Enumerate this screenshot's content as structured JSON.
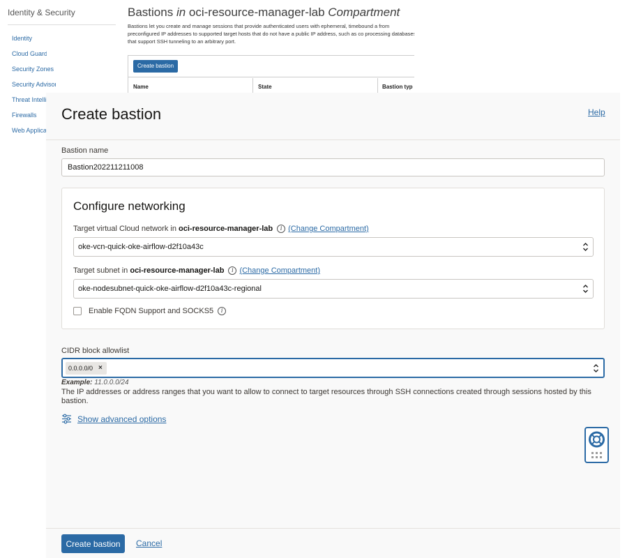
{
  "background_page": {
    "sidebar": {
      "title": "Identity & Security",
      "items": [
        "Identity",
        "Cloud Guard",
        "Security Zones",
        "Security Advisor",
        "Threat Intelli",
        "Firewalls",
        "Web Applica"
      ]
    },
    "title_prefix": "Bastions",
    "title_in": "in",
    "title_compartment": "oci-resource-manager-lab",
    "title_suffix": "Compartment",
    "description": "Bastions let you create and manage sessions that provide authenticated users with ephemeral, timebound a from preconfigured IP addresses to supported target hosts that do not have a public IP address, such as co processing databases that support SSH tunneling to an arbitrary port.",
    "create_button": "Create bastion",
    "columns": [
      "Name",
      "State",
      "Bastion typ"
    ]
  },
  "panel": {
    "title": "Create bastion",
    "help_link": "Help",
    "bastion_name_label": "Bastion name",
    "bastion_name_value": "Bastion202211211008",
    "networking": {
      "title": "Configure networking",
      "vcn_label_prefix": "Target virtual Cloud network in",
      "vcn_label_compartment": "oci-resource-manager-lab",
      "vcn_change_link": "(Change Compartment)",
      "vcn_value": "oke-vcn-quick-oke-airflow-d2f10a43c",
      "subnet_label_prefix": "Target subnet in",
      "subnet_label_compartment": "oci-resource-manager-lab",
      "subnet_change_link": "(Change Compartment)",
      "subnet_value": "oke-nodesubnet-quick-oke-airflow-d2f10a43c-regional",
      "fqdn_checkbox_label": "Enable FQDN Support and SOCKS5",
      "fqdn_checked": false
    },
    "cidr": {
      "label": "CIDR block allowlist",
      "chip": "0.0.0.0/0",
      "chip_remove": "×",
      "example_label": "Example:",
      "example_value": "11.0.0.0/24",
      "help_text": "The IP addresses or address ranges that you want to allow to connect to target resources through SSH connections created through sessions hosted by this bastion."
    },
    "advanced_link": "Show advanced options",
    "footer": {
      "primary": "Create bastion",
      "cancel": "Cancel"
    }
  },
  "colors": {
    "accent": "#2b6aa5",
    "panel_bg": "#f9f9f9"
  },
  "icons": {
    "info": "info-icon",
    "chevron": "up-down-chevron-icon",
    "advanced": "sliders-icon",
    "help_widget": "lifebuoy-icon"
  }
}
